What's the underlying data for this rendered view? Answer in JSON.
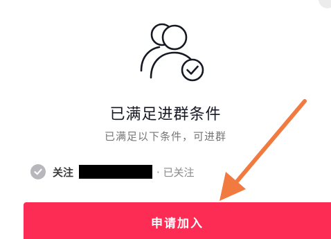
{
  "dialog": {
    "title": "已满足进群条件",
    "subtitle": "已满足以下条件，可进群",
    "condition": {
      "label": "关注",
      "status": "· 已关注",
      "met": true
    },
    "join_button_label": "申请加入"
  },
  "icons": {
    "group": "group-members-check-icon",
    "condition": "check-circle-icon",
    "close": "close-icon"
  },
  "colors": {
    "primary": "#fc2c55",
    "annotation_arrow": "#f07a40",
    "check_badge": "#b8b8bc"
  }
}
